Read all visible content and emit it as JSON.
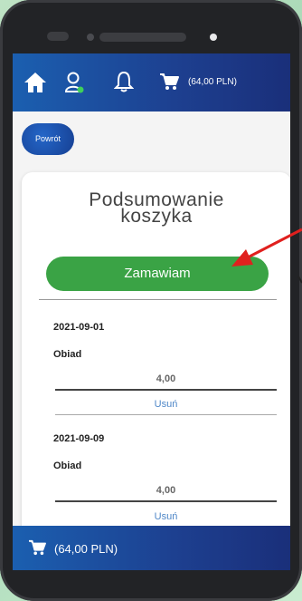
{
  "header": {
    "cart_amount": "(64,00 PLN)"
  },
  "back_button": "Powrót",
  "summary": {
    "title_line1": "Podsumowanie",
    "title_line2": "koszyka",
    "order_button": "Zamawiam",
    "items": [
      {
        "date": "2021-09-01",
        "name": "Obiad",
        "price": "4,00",
        "remove": "Usuń"
      },
      {
        "date": "2021-09-09",
        "name": "Obiad",
        "price": "4,00",
        "remove": "Usuń"
      }
    ]
  },
  "footer": {
    "cart_amount": "(64,00 PLN)"
  },
  "colors": {
    "primary": "#1d3f8f",
    "accent": "#3aa345",
    "link": "#4d86c7",
    "arrow": "#e0201e"
  },
  "icons": [
    "home-icon",
    "user-icon",
    "bell-icon",
    "cart-icon"
  ]
}
